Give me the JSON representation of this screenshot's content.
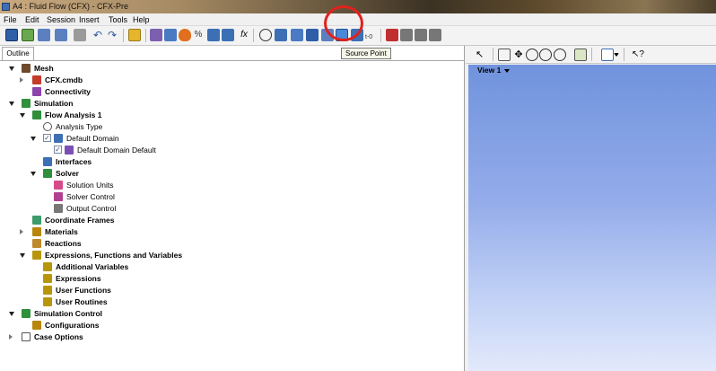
{
  "window": {
    "title": "A4 : Fluid Flow (CFX) - CFX-Pre"
  },
  "menu": [
    "File",
    "Edit",
    "Session",
    "Insert",
    "Tools",
    "Help"
  ],
  "tooltip": "Source Point",
  "outline": {
    "tab": "Outline",
    "tree": [
      {
        "label": "Mesh",
        "bold": true,
        "level": 0,
        "toggle": "open",
        "icon": "mesh-icon"
      },
      {
        "label": "CFX.cmdb",
        "bold": true,
        "level": 1,
        "toggle": "closed",
        "icon": "mesh-file-icon"
      },
      {
        "label": "Connectivity",
        "bold": true,
        "level": 1,
        "toggle": "none",
        "icon": "connectivity-icon"
      },
      {
        "label": "Simulation",
        "bold": true,
        "level": 0,
        "toggle": "open",
        "icon": "simulation-icon"
      },
      {
        "label": "Flow Analysis 1",
        "bold": true,
        "level": 1,
        "toggle": "open",
        "icon": "flow-analysis-icon"
      },
      {
        "label": "Analysis Type",
        "bold": false,
        "level": 2,
        "toggle": "none",
        "icon": "clock-icon"
      },
      {
        "label": "Default Domain",
        "bold": false,
        "level": 2,
        "toggle": "open",
        "icon": "domain-icon",
        "checkbox": true
      },
      {
        "label": "Default Domain Default",
        "bold": false,
        "level": 3,
        "toggle": "none",
        "icon": "boundary-icon",
        "checkbox": true
      },
      {
        "label": "Interfaces",
        "bold": true,
        "level": 2,
        "toggle": "none",
        "icon": "interfaces-icon"
      },
      {
        "label": "Solver",
        "bold": true,
        "level": 2,
        "toggle": "open",
        "icon": "solver-icon"
      },
      {
        "label": "Solution Units",
        "bold": false,
        "level": 3,
        "toggle": "none",
        "icon": "solution-units-icon"
      },
      {
        "label": "Solver Control",
        "bold": false,
        "level": 3,
        "toggle": "none",
        "icon": "solver-control-icon"
      },
      {
        "label": "Output Control",
        "bold": false,
        "level": 3,
        "toggle": "none",
        "icon": "output-control-icon"
      },
      {
        "label": "Coordinate Frames",
        "bold": true,
        "level": 1,
        "toggle": "none",
        "icon": "coordinate-frames-icon"
      },
      {
        "label": "Materials",
        "bold": true,
        "level": 1,
        "toggle": "closed",
        "icon": "materials-icon"
      },
      {
        "label": "Reactions",
        "bold": true,
        "level": 1,
        "toggle": "none",
        "icon": "reactions-icon"
      },
      {
        "label": "Expressions, Functions and Variables",
        "bold": true,
        "level": 1,
        "toggle": "open",
        "icon": "expressions-group-icon"
      },
      {
        "label": "Additional Variables",
        "bold": true,
        "level": 2,
        "toggle": "none",
        "icon": "additional-variables-icon"
      },
      {
        "label": "Expressions",
        "bold": true,
        "level": 2,
        "toggle": "none",
        "icon": "expressions-icon"
      },
      {
        "label": "User Functions",
        "bold": true,
        "level": 2,
        "toggle": "none",
        "icon": "user-functions-icon"
      },
      {
        "label": "User Routines",
        "bold": true,
        "level": 2,
        "toggle": "none",
        "icon": "user-routines-icon"
      },
      {
        "label": "Simulation Control",
        "bold": true,
        "level": 0,
        "toggle": "open",
        "icon": "simulation-control-icon"
      },
      {
        "label": "Configurations",
        "bold": true,
        "level": 1,
        "toggle": "none",
        "icon": "configurations-icon"
      },
      {
        "label": "Case Options",
        "bold": true,
        "level": 0,
        "toggle": "closed",
        "icon": "case-options-icon"
      }
    ]
  },
  "viewport": {
    "label": "View 1"
  },
  "colors": {
    "highlight_circle": "#e2211c",
    "viewport_top": "#7093dd",
    "viewport_bottom": "#e2e9fb"
  }
}
